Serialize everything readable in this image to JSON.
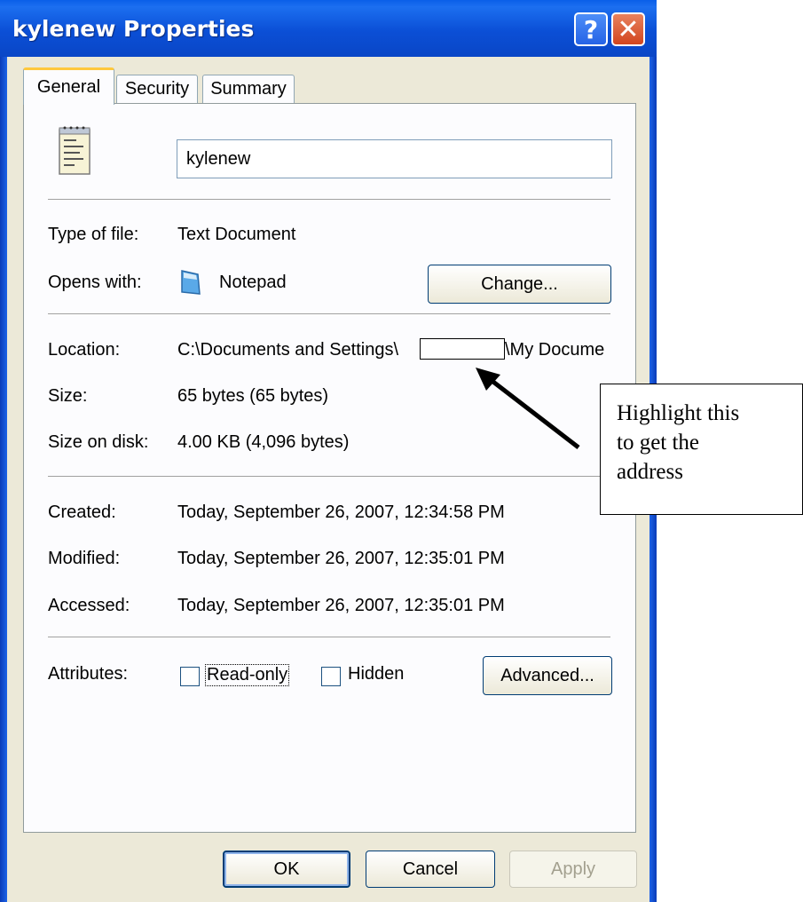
{
  "window": {
    "title": "kylenew Properties"
  },
  "tabs": [
    {
      "label": "General"
    },
    {
      "label": "Security"
    },
    {
      "label": "Summary"
    }
  ],
  "file": {
    "name": "kylenew",
    "type_label": "Type of file:",
    "type_value": "Text Document",
    "opens_label": "Opens with:",
    "opens_value": "Notepad",
    "change_button": "Change...",
    "location_label": "Location:",
    "location_prefix": "C:\\Documents and Settings\\",
    "location_suffix": "\\My Docume",
    "size_label": "Size:",
    "size_value": "65 bytes (65 bytes)",
    "size_disk_label": "Size on disk:",
    "size_disk_value": "4.00 KB (4,096 bytes)",
    "created_label": "Created:",
    "created_value": "Today, September 26, 2007, 12:34:58 PM",
    "modified_label": "Modified:",
    "modified_value": "Today, September 26, 2007, 12:35:01 PM",
    "accessed_label": "Accessed:",
    "accessed_value": "Today, September 26, 2007, 12:35:01 PM",
    "attributes_label": "Attributes:",
    "readonly_label": "Read-only",
    "hidden_label": "Hidden",
    "advanced_button": "Advanced..."
  },
  "footer": {
    "ok": "OK",
    "cancel": "Cancel",
    "apply": "Apply"
  },
  "callout": {
    "line1": "Highlight this",
    "line2": "to get the",
    "line3": "address"
  },
  "icons": {
    "file": "notepad-document-icon",
    "app": "notepad-app-icon",
    "help": "help-icon",
    "close": "close-icon"
  }
}
